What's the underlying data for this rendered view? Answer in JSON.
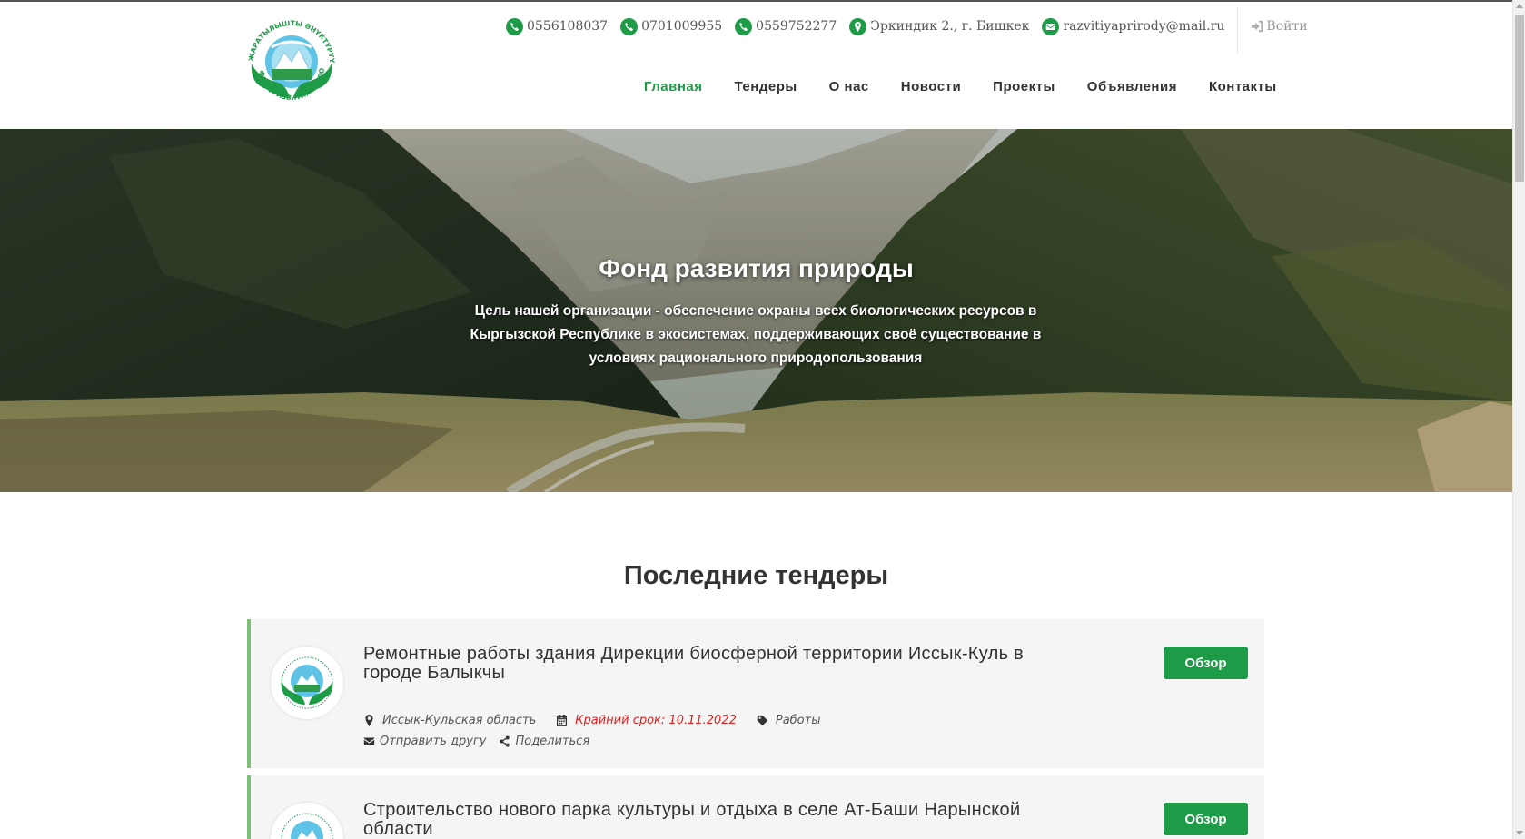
{
  "header": {
    "logo_alt": "Фонд развития природы",
    "contacts": {
      "phone1": "0556108037",
      "phone2": "0701009955",
      "phone3": "0559752277",
      "address": "Эркиндик 2., г. Бишкек",
      "email": "razvitiyaprirody@mail.ru",
      "login": "Войти"
    },
    "icons": {
      "phone": "phone-icon",
      "address": "map-marker-icon",
      "email": "envelope-icon",
      "login": "sign-in-icon"
    },
    "nav": [
      "Главная",
      "Тендеры",
      "О нас",
      "Новости",
      "Проекты",
      "Объявления",
      "Контакты"
    ],
    "accent_color": "#1e9b47"
  },
  "hero": {
    "title": "Фонд развития природы",
    "subtitle": "Цель нашей организации - обеспечение охраны всех биологических ресурсов в Кыргызской Республике в экосистемах, поддерживающих своё существование в условиях рационального природопользования"
  },
  "tenders_section": {
    "title": "Последние тендеры",
    "items": [
      {
        "title": "Ремонтные работы здания Дирекции биосферной территории Иссык-Куль в городе Балыкчы",
        "region": "Иссык-Кульская область",
        "deadline": "Крайний срок: 10.11.2022",
        "category": "Работы",
        "send": "Отправить другу",
        "share": "Поделиться",
        "button": "Обзор"
      },
      {
        "title": "Строительство нового парка культуры и отдыха в селе Ат-Баши Нарынской области",
        "button": "Обзор"
      }
    ]
  }
}
